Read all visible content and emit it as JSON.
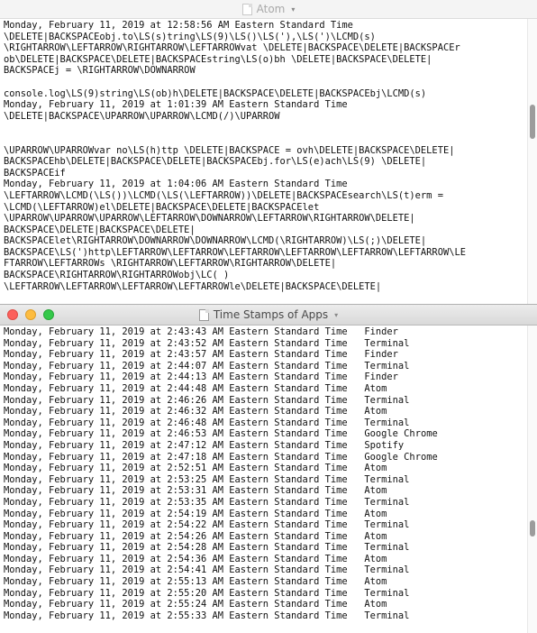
{
  "windows": {
    "atom": {
      "title": "Atom",
      "lines": [
        "Monday, February 11, 2019 at 12:58:56 AM Eastern Standard Time",
        "\\DELETE|BACKSPACEobj.to\\LS(s)tring\\LS(9)\\LS()\\LS('),\\LS(')\\LCMD(s)",
        "\\RIGHTARROW\\LEFTARROW\\RIGHTARROW\\LEFTARROWvat \\DELETE|BACKSPACE\\DELETE|BACKSPACEr",
        "ob\\DELETE|BACKSPACE\\DELETE|BACKSPACEstring\\LS(o)bh \\DELETE|BACKSPACE\\DELETE|",
        "BACKSPACEj = \\RIGHTARROW\\DOWNARROW",
        "",
        "console.log\\LS(9)string\\LS(ob)h\\DELETE|BACKSPACE\\DELETE|BACKSPACEbj\\LCMD(s)",
        "Monday, February 11, 2019 at 1:01:39 AM Eastern Standard Time",
        "\\DELETE|BACKSPACE\\UPARROW\\UPARROW\\LCMD(/)\\UPARROW",
        "",
        "",
        "\\UPARROW\\UPARROWvar no\\LS(h)ttp \\DELETE|BACKSPACE = ovh\\DELETE|BACKSPACE\\DELETE|",
        "BACKSPACEhb\\DELETE|BACKSPACE\\DELETE|BACKSPACEbj.for\\LS(e)ach\\LS(9) \\DELETE|",
        "BACKSPACEif",
        "Monday, February 11, 2019 at 1:04:06 AM Eastern Standard Time",
        "\\LEFTARROW\\LCMD(\\LS())\\LCMD(\\LS(\\LEFTARROW))\\DELETE|BACKSPACEsearch\\LS(t)erm =",
        "\\LCMD(\\LEFTARROW)el\\DELETE|BACKSPACE\\DELETE|BACKSPACElet",
        "\\UPARROW\\UPARROW\\UPARROW\\LEFTARROW\\DOWNARROW\\LEFTARROW\\RIGHTARROW\\DELETE|",
        "BACKSPACE\\DELETE|BACKSPACE\\DELETE|",
        "BACKSPACElet\\RIGHTARROW\\DOWNARROW\\DOWNARROW\\LCMD(\\RIGHTARROW)\\LS(;)\\DELETE|",
        "BACKSPACE\\LS(')http\\LEFTARROW\\LEFTARROW\\LEFTARROW\\LEFTARROW\\LEFTARROW\\LEFTARROW\\LE",
        "FTARROW\\LEFTARROWs \\RIGHTARROW\\LEFTARROW\\RIGHTARROW\\DELETE|",
        "BACKSPACE\\RIGHTARROW\\RIGHTARROWobj\\LC( )",
        "\\LEFTARROW\\LEFTARROW\\LEFTARROW\\LEFTARROWle\\DELETE|BACKSPACE\\DELETE|"
      ]
    },
    "timestamps": {
      "title": "Time Stamps of Apps",
      "rows": [
        {
          "time": "Monday, February 11, 2019 at 2:43:43 AM Eastern Standard Time",
          "app": "Finder"
        },
        {
          "time": "Monday, February 11, 2019 at 2:43:52 AM Eastern Standard Time",
          "app": "Terminal"
        },
        {
          "time": "Monday, February 11, 2019 at 2:43:57 AM Eastern Standard Time",
          "app": "Finder"
        },
        {
          "time": "Monday, February 11, 2019 at 2:44:07 AM Eastern Standard Time",
          "app": "Terminal"
        },
        {
          "time": "Monday, February 11, 2019 at 2:44:13 AM Eastern Standard Time",
          "app": "Finder"
        },
        {
          "time": "Monday, February 11, 2019 at 2:44:48 AM Eastern Standard Time",
          "app": "Atom"
        },
        {
          "time": "Monday, February 11, 2019 at 2:46:26 AM Eastern Standard Time",
          "app": "Terminal"
        },
        {
          "time": "Monday, February 11, 2019 at 2:46:32 AM Eastern Standard Time",
          "app": "Atom"
        },
        {
          "time": "Monday, February 11, 2019 at 2:46:48 AM Eastern Standard Time",
          "app": "Terminal"
        },
        {
          "time": "Monday, February 11, 2019 at 2:46:53 AM Eastern Standard Time",
          "app": "Google Chrome"
        },
        {
          "time": "Monday, February 11, 2019 at 2:47:12 AM Eastern Standard Time",
          "app": "Spotify"
        },
        {
          "time": "Monday, February 11, 2019 at 2:47:18 AM Eastern Standard Time",
          "app": "Google Chrome"
        },
        {
          "time": "Monday, February 11, 2019 at 2:52:51 AM Eastern Standard Time",
          "app": "Atom"
        },
        {
          "time": "Monday, February 11, 2019 at 2:53:25 AM Eastern Standard Time",
          "app": "Terminal"
        },
        {
          "time": "Monday, February 11, 2019 at 2:53:31 AM Eastern Standard Time",
          "app": "Atom"
        },
        {
          "time": "Monday, February 11, 2019 at 2:53:35 AM Eastern Standard Time",
          "app": "Terminal"
        },
        {
          "time": "Monday, February 11, 2019 at 2:54:19 AM Eastern Standard Time",
          "app": "Atom"
        },
        {
          "time": "Monday, February 11, 2019 at 2:54:22 AM Eastern Standard Time",
          "app": "Terminal"
        },
        {
          "time": "Monday, February 11, 2019 at 2:54:26 AM Eastern Standard Time",
          "app": "Atom"
        },
        {
          "time": "Monday, February 11, 2019 at 2:54:28 AM Eastern Standard Time",
          "app": "Terminal"
        },
        {
          "time": "Monday, February 11, 2019 at 2:54:36 AM Eastern Standard Time",
          "app": "Atom"
        },
        {
          "time": "Monday, February 11, 2019 at 2:54:41 AM Eastern Standard Time",
          "app": "Terminal"
        },
        {
          "time": "Monday, February 11, 2019 at 2:55:13 AM Eastern Standard Time",
          "app": "Atom"
        },
        {
          "time": "Monday, February 11, 2019 at 2:55:20 AM Eastern Standard Time",
          "app": "Terminal"
        },
        {
          "time": "Monday, February 11, 2019 at 2:55:24 AM Eastern Standard Time",
          "app": "Atom"
        },
        {
          "time": "Monday, February 11, 2019 at 2:55:33 AM Eastern Standard Time",
          "app": "Terminal"
        }
      ]
    }
  },
  "icons": {
    "document": "document-icon",
    "chevron": "chevron-down-icon",
    "close": "close-button",
    "minimize": "minimize-button",
    "zoom": "zoom-button"
  },
  "colors": {
    "close": "#fc605c",
    "minimize": "#fdbc40",
    "zoom": "#34c84a"
  }
}
